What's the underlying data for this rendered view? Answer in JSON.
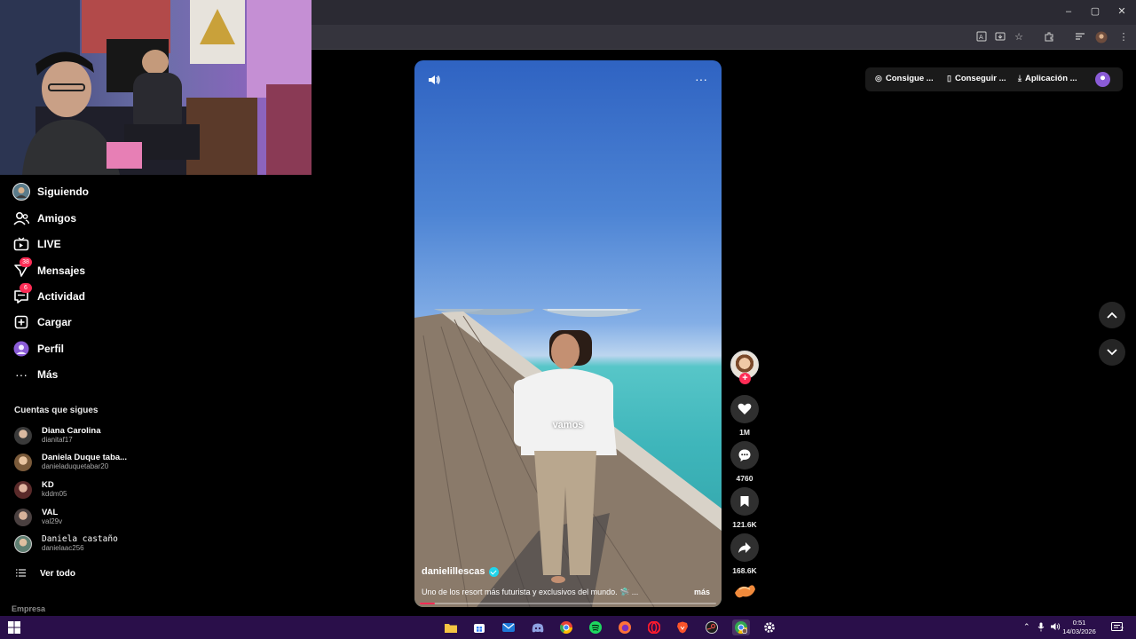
{
  "browser": {
    "window_buttons": [
      "–",
      "▢",
      "✕"
    ]
  },
  "sidebar": {
    "items": [
      {
        "label": "Siguiendo",
        "icon": "following-avatar-icon"
      },
      {
        "label": "Amigos",
        "icon": "friends-icon"
      },
      {
        "label": "LIVE",
        "icon": "live-icon"
      },
      {
        "label": "Mensajes",
        "icon": "messages-icon",
        "badge": "38"
      },
      {
        "label": "Actividad",
        "icon": "activity-icon",
        "badge": "6"
      },
      {
        "label": "Cargar",
        "icon": "upload-icon"
      },
      {
        "label": "Perfil",
        "icon": "profile-avatar-icon"
      },
      {
        "label": "Más",
        "icon": "more-icon"
      }
    ],
    "following_title": "Cuentas que sigues",
    "accounts": [
      {
        "name": "Diana Carolina",
        "handle": "dianitaf17"
      },
      {
        "name": "Daniela Duque taba...",
        "handle": "danieladuquetabar20"
      },
      {
        "name": "KD",
        "handle": "kddm05"
      },
      {
        "name": "VAL",
        "handle": "val29v"
      },
      {
        "name": "Daniela castaño",
        "handle": "danielaac256"
      }
    ],
    "see_all": "Ver todo",
    "footer": "Empresa"
  },
  "header": {
    "coins_label": "Consigue ...",
    "app_label": "Conseguir ...",
    "download_label": "Aplicación ..."
  },
  "video": {
    "caption_word": "vamos",
    "author": "danielillescas",
    "description": "Uno de los resort más futurista y exclusivos del mundo. 🛸 ...",
    "more_label": "más",
    "progress": 0.05
  },
  "actions": {
    "likes": "1M",
    "comments": "4760",
    "saves": "121.6K",
    "shares": "168.6K"
  },
  "taskbar": {
    "time": "0:51",
    "date": "14/03/2026",
    "notifications": "2"
  },
  "colors": {
    "accent": "#fe2c55",
    "taskbar": "#2a0f4a",
    "verified": "#20d5ec"
  }
}
